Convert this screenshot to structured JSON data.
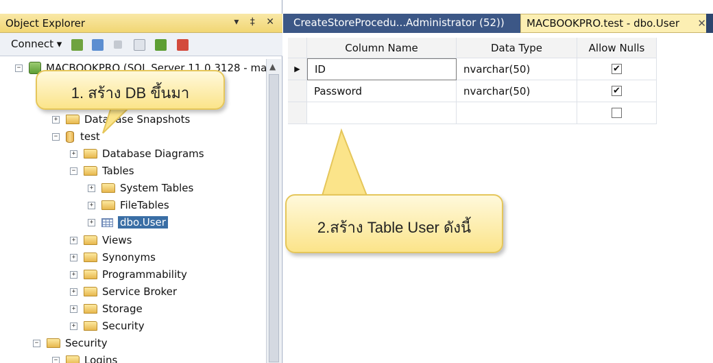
{
  "object_explorer": {
    "title": "Object Explorer",
    "title_buttons": "▾ ‡ ✕",
    "toolbar": {
      "connect_label": "Connect ▾"
    },
    "tree": {
      "server": "MACBOOKPRO (SQL Server 11.0.3128 - ma",
      "database_snapshots": "Database Snapshots",
      "test_db": "test",
      "database_diagrams": "Database Diagrams",
      "tables": "Tables",
      "system_tables": "System Tables",
      "file_tables": "FileTables",
      "dbo_user": "dbo.User",
      "views": "Views",
      "synonyms": "Synonyms",
      "programmability": "Programmability",
      "service_broker": "Service Broker",
      "storage": "Storage",
      "security_db": "Security",
      "security_server": "Security",
      "logins": "Logins"
    }
  },
  "tabs": {
    "tab1": "CreateStoreProcedu...Administrator (52))",
    "tab2": "MACBOOKPRO.test - dbo.User",
    "tab2_close": "✕"
  },
  "table_designer": {
    "headers": {
      "column_name": "Column Name",
      "data_type": "Data Type",
      "allow_nulls": "Allow Nulls"
    },
    "rows": [
      {
        "name": "ID",
        "type": "nvarchar(50)",
        "allow_nulls": "✔"
      },
      {
        "name": "Password",
        "type": "nvarchar(50)",
        "allow_nulls": "✔"
      },
      {
        "name": "",
        "type": "",
        "allow_nulls": ""
      }
    ],
    "row_indicator": "▶"
  },
  "callouts": {
    "step1": "1. สร้าง DB ขึ้นมา",
    "step2": "2.สร้าง Table User ดังนี้"
  },
  "colors": {
    "tab_bar": "#3c5786",
    "selection": "#3a6ea5",
    "callout": "#fbe48a"
  }
}
